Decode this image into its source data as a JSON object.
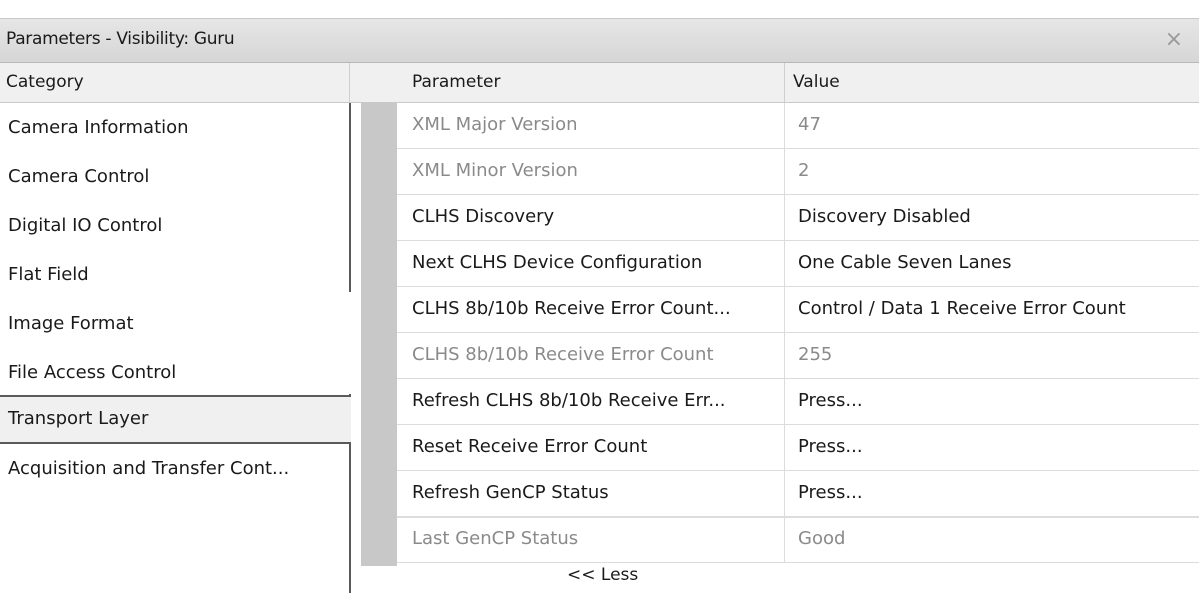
{
  "window": {
    "title": "Parameters - Visibility: Guru",
    "close_icon": "×"
  },
  "headers": {
    "category": "Category",
    "parameter": "Parameter",
    "value": "Value"
  },
  "categories": [
    {
      "label": "Camera Information"
    },
    {
      "label": "Camera Control"
    },
    {
      "label": "Digital IO Control"
    },
    {
      "label": "Flat Field"
    },
    {
      "label": "Image Format"
    },
    {
      "label": "File Access Control"
    },
    {
      "label": "Transport Layer",
      "selected": true
    },
    {
      "label": "Acquisition and Transfer Cont..."
    }
  ],
  "parameters": [
    {
      "name": "XML Major Version",
      "value": "47",
      "read_only": true
    },
    {
      "name": "XML Minor Version",
      "value": "2",
      "read_only": true
    },
    {
      "name": "CLHS Discovery",
      "value": "Discovery Disabled",
      "read_only": false
    },
    {
      "name": "Next CLHS Device Configuration",
      "value": "One Cable Seven Lanes",
      "read_only": false
    },
    {
      "name": "CLHS 8b/10b Receive Error Count...",
      "value": "Control / Data 1 Receive Error Count",
      "read_only": false
    },
    {
      "name": "CLHS 8b/10b Receive Error Count",
      "value": "255",
      "read_only": true
    },
    {
      "name": "Refresh CLHS 8b/10b Receive Err...",
      "value": "Press...",
      "read_only": false
    },
    {
      "name": "Reset Receive Error Count",
      "value": "Press...",
      "read_only": false
    },
    {
      "name": "Refresh GenCP Status",
      "value": "Press...",
      "read_only": false
    },
    {
      "name": "Last GenCP Status",
      "value": "Good",
      "read_only": true
    }
  ],
  "less_button": "<< Less",
  "colors": {
    "read_only_text": "#8a8a8a",
    "selected_bg": "#f0f0f0",
    "gutter": "#c8c8c8"
  }
}
